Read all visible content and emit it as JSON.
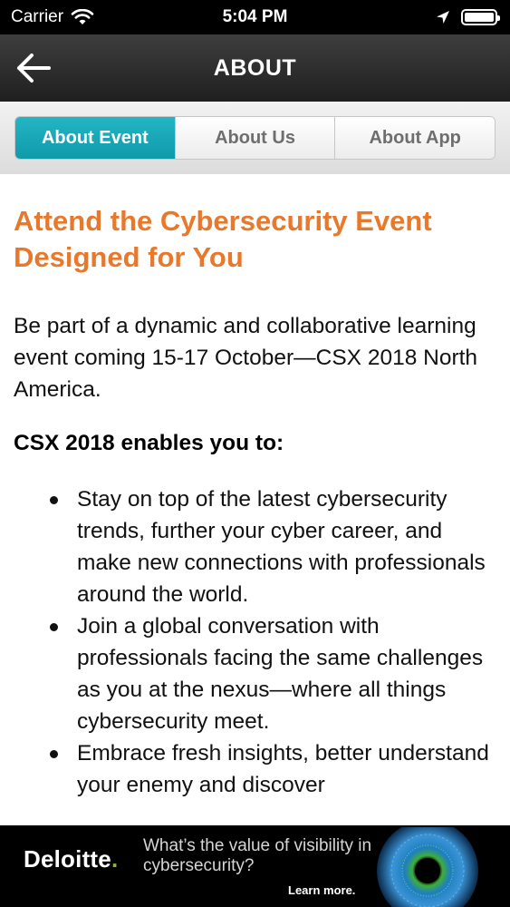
{
  "status_bar": {
    "carrier": "Carrier",
    "time": "5:04 PM"
  },
  "nav": {
    "title": "ABOUT"
  },
  "tabs": [
    {
      "label": "About Event",
      "active": true
    },
    {
      "label": "About Us",
      "active": false
    },
    {
      "label": "About App",
      "active": false
    }
  ],
  "content": {
    "headline": "Attend the Cybersecurity Event Designed for You",
    "intro": "Be part of a dynamic and collaborative learning event coming 15-17 October—CSX 2018 North America.",
    "subhead": "CSX 2018 enables you to:",
    "bullets": [
      "Stay on top of the latest cybersecurity trends, further your cyber career, and make new connections with professionals around the world.",
      "Join a global conversation with professionals facing the same challenges as you at the nexus—where all things cybersecurity meet.",
      "Embrace fresh insights, better understand your enemy and discover"
    ]
  },
  "ad": {
    "brand": "Deloitte",
    "brand_dot": ".",
    "text": "What’s the value of visibility in cybersecurity?",
    "cta": "Learn more."
  },
  "colors": {
    "accent_teal": "#13a3b3",
    "headline_orange": "#e8792c",
    "brand_green": "#86bc25"
  }
}
